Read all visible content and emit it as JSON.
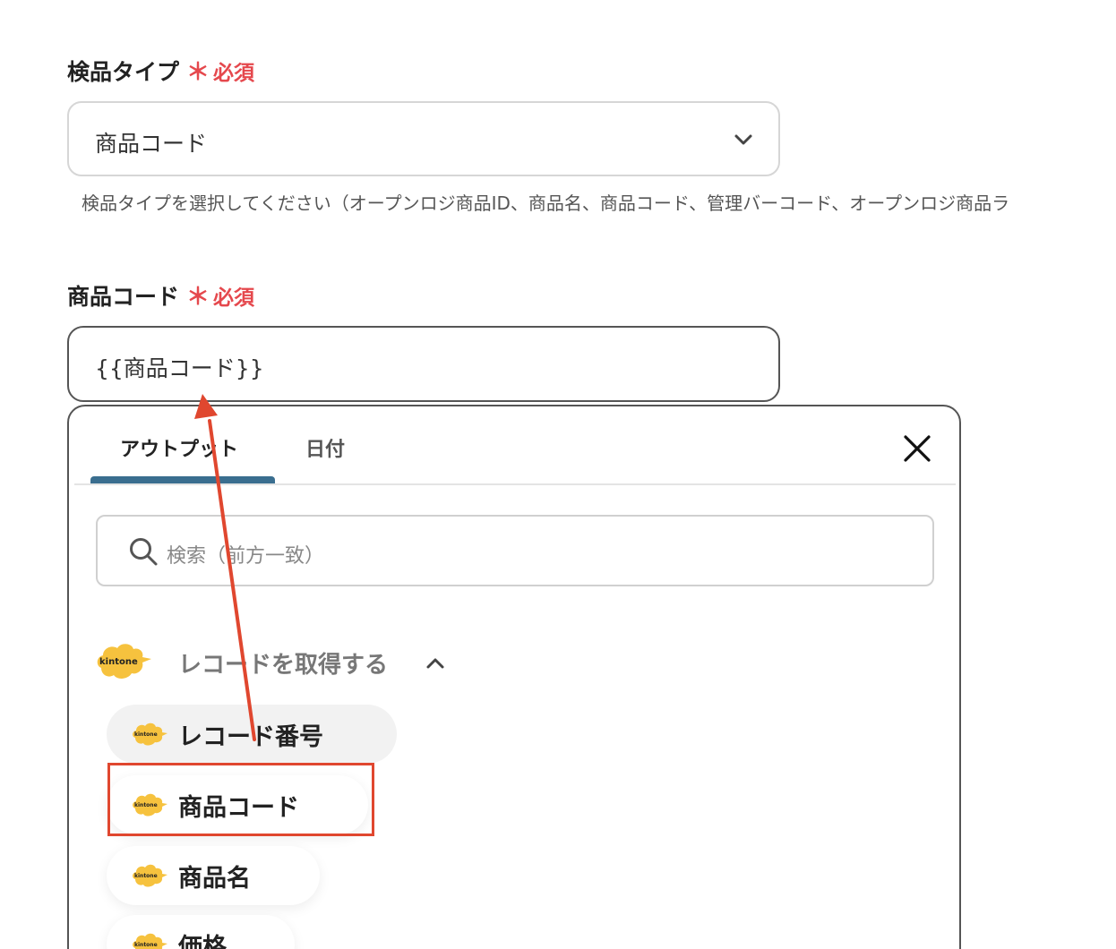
{
  "field1": {
    "label": "検品タイプ",
    "required_mark": "＊",
    "required_text": "必須",
    "selected_value": "商品コード",
    "help_text": "検品タイプを選択してください（オープンロジ商品ID、商品名、商品コード、管理バーコード、オープンロジ商品ラ"
  },
  "field2": {
    "label": "商品コード",
    "required_mark": "＊",
    "required_text": "必須",
    "value": "{{商品コード}}"
  },
  "popup": {
    "tabs": [
      {
        "label": "アウトプット",
        "active": true
      },
      {
        "label": "日付",
        "active": false
      }
    ],
    "search_placeholder": "検索（前方一致）",
    "group": {
      "logo_text": "kintone",
      "title": "レコードを取得する",
      "expanded": true
    },
    "items": [
      {
        "label": "レコード番号",
        "logo_text": "kintone",
        "hovered": true
      },
      {
        "label": "商品コード",
        "logo_text": "kintone",
        "highlighted": true
      },
      {
        "label": "商品名",
        "logo_text": "kintone"
      },
      {
        "label": "価格",
        "logo_text": "kintone"
      }
    ]
  },
  "colors": {
    "required": "#e5484d",
    "tab_accent": "#3a6e8f",
    "annotation": "#e0472f",
    "kintone_yellow": "#f6c23e"
  },
  "icons": [
    "chevron-down-icon",
    "close-icon",
    "search-icon",
    "chevron-up-icon",
    "kintone-logo-icon"
  ]
}
